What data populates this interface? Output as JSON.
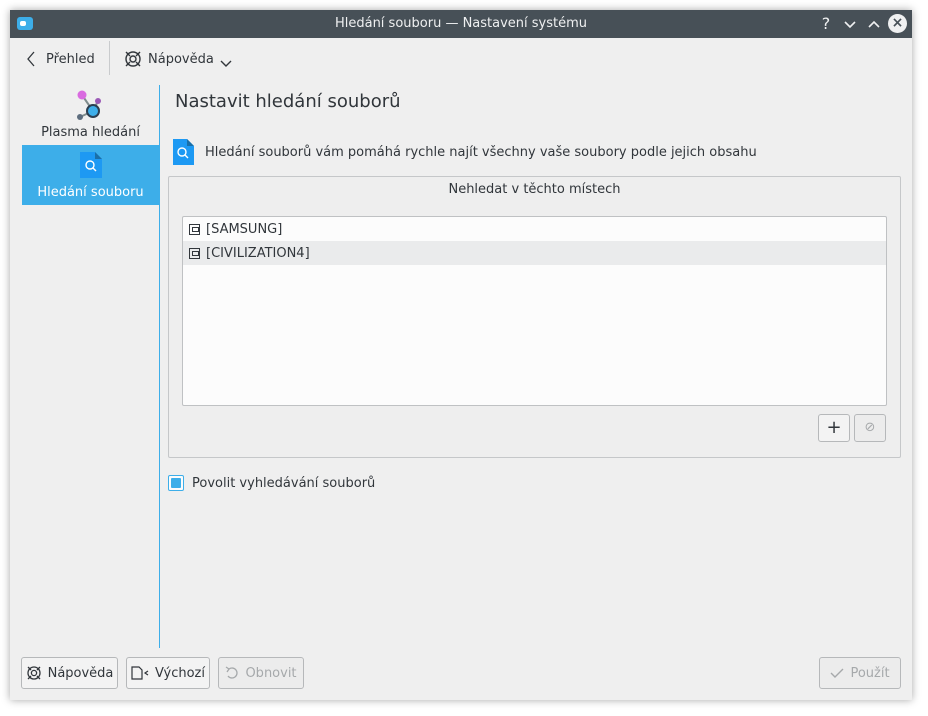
{
  "window": {
    "title": "Hledání souboru  — Nastavení systému",
    "help_glyph": "?",
    "minimize_glyph": "⌄",
    "maximize_glyph": "⌃",
    "close_glyph": "×"
  },
  "toolbar": {
    "back_label": "Přehled",
    "help_label": "Nápověda"
  },
  "sidebar": {
    "items": [
      {
        "label": "Plasma hledání",
        "icon": "plasma-search-icon",
        "active": false
      },
      {
        "label": "Hledání souboru",
        "icon": "file-search-icon",
        "active": true
      }
    ]
  },
  "content": {
    "page_title": "Nastavit hledání souborů",
    "info_text": "Hledání souborů vám pomáhá rychle najít všechny vaše soubory podle jejich obsahu",
    "exclude_group_title": "Nehledat v těchto místech",
    "excluded_folders": [
      "[SAMSUNG]",
      "[CIVILIZATION4]"
    ],
    "add_glyph": "+",
    "remove_glyph": "⊘",
    "enable_label": "Povolit vyhledávání souborů",
    "enable_checked": true
  },
  "footer": {
    "help_label": "Nápověda",
    "defaults_label": "Výchozí",
    "reset_label": "Obnovit",
    "apply_label": "Použít"
  },
  "colors": {
    "accent": "#3daee9",
    "titlebar": "#475057",
    "background": "#efefef"
  }
}
